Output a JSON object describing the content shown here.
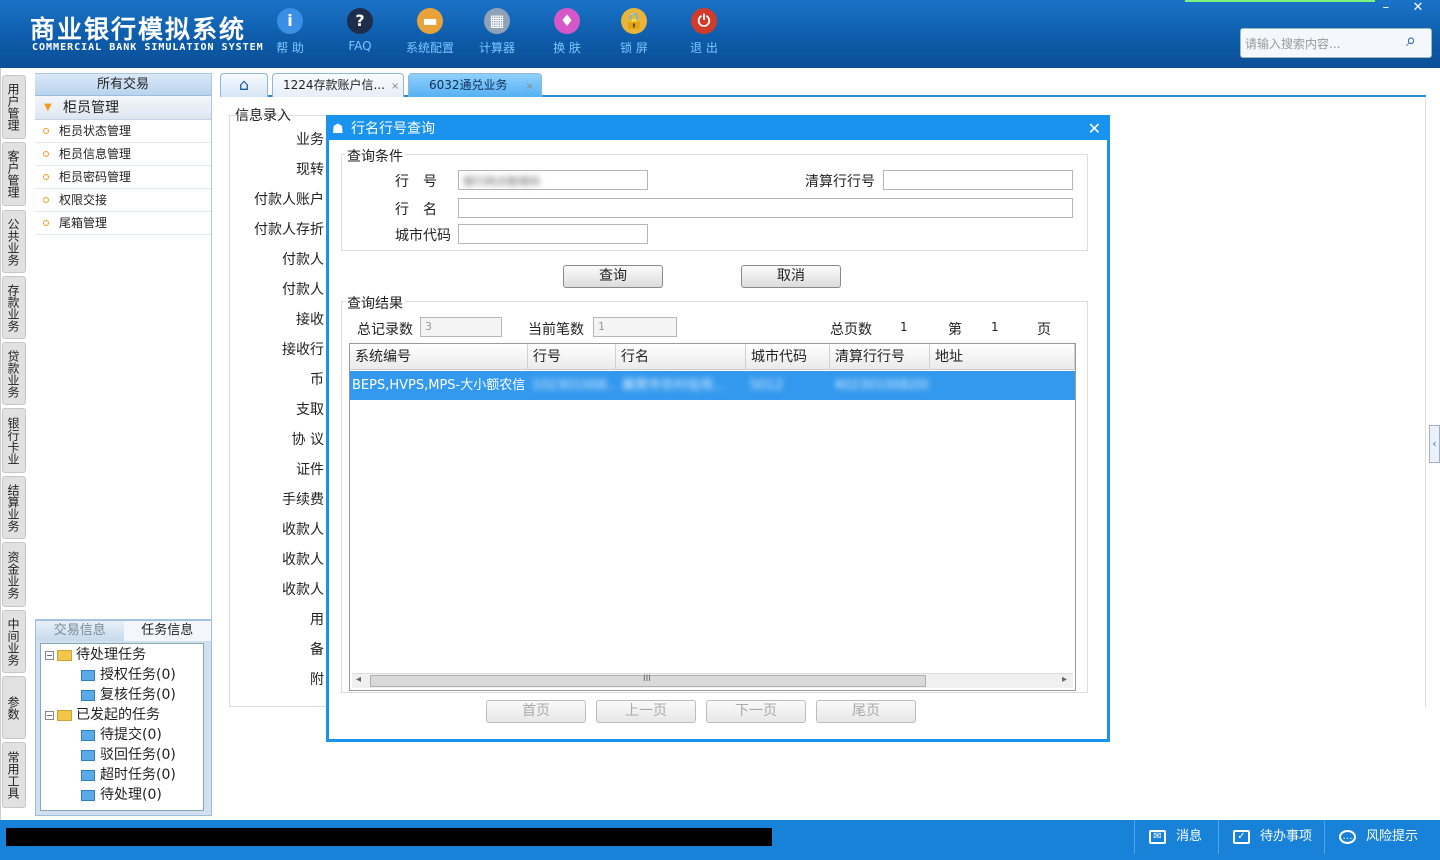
{
  "brand": {
    "cn": "商业银行模拟系统",
    "en": "COMMERCIAL BANK SIMULATION SYSTEM"
  },
  "toolbar": [
    {
      "label": "帮 助",
      "glyph": "i",
      "icon": "help-icon",
      "color": "#3a8ee6"
    },
    {
      "label": "FAQ",
      "glyph": "?",
      "icon": "faq-icon",
      "color": "#1e2d4a"
    },
    {
      "label": "系统配置",
      "glyph": "▬",
      "icon": "toolbox-icon",
      "color": "#e8a23a"
    },
    {
      "label": "计算器",
      "glyph": "▦",
      "icon": "calculator-icon",
      "color": "#8fa2b8"
    },
    {
      "label": "换 肤",
      "glyph": "♦",
      "icon": "skin-icon",
      "color": "#d657c8"
    },
    {
      "label": "锁 屏",
      "glyph": "🔒",
      "icon": "lock-icon",
      "color": "#e8b53a"
    },
    {
      "label": "退 出",
      "glyph": "⏻",
      "icon": "power-icon",
      "color": "#d23a2a"
    }
  ],
  "window": {
    "minimize": "–",
    "close": "✕"
  },
  "search": {
    "placeholder": "请输入搜索内容..."
  },
  "left_tabs": [
    "用户管理",
    "客户管理",
    "公共业务",
    "存款业务",
    "贷款业务",
    "银行卡业务",
    "结算业务",
    "资金业务",
    "中间业务",
    "参数",
    "常用工具"
  ],
  "nav": {
    "header": "所有交易",
    "group": "柜员管理",
    "items": [
      "柜员状态管理",
      "柜员信息管理",
      "柜员密码管理",
      "权限交接",
      "尾箱管理"
    ]
  },
  "task_panel": {
    "tab_trans": "交易信息",
    "tab_task": "任务信息",
    "tree": [
      {
        "label": "待处理任务",
        "level": 0,
        "folder": true
      },
      {
        "label": "授权任务(0)",
        "level": 1
      },
      {
        "label": "复核任务(0)",
        "level": 1
      },
      {
        "label": "已发起的任务",
        "level": 0,
        "folder": true
      },
      {
        "label": "待提交(0)",
        "level": 1
      },
      {
        "label": "驳回任务(0)",
        "level": 1
      },
      {
        "label": "超时任务(0)",
        "level": 1
      },
      {
        "label": "待处理(0)",
        "level": 1
      }
    ]
  },
  "tabs": {
    "home": "⌂",
    "tab1": "1224存款账户信...",
    "tab2": "6032通兑业务",
    "close": "×"
  },
  "form": {
    "legend": "信息录入",
    "labels": [
      "业务",
      "现转",
      "付款人账户",
      "付款人存折",
      "付款人",
      "付款人",
      "接收",
      "接收行",
      "币",
      "支取",
      "协 议",
      "证件",
      "手续费",
      "收款人",
      "收款人",
      "收款人",
      "用",
      "备",
      "附"
    ]
  },
  "dialog": {
    "title": "行名行号查询",
    "close": "✕",
    "query_legend": "查询条件",
    "bank_no_label": "行　号",
    "bank_no_value": "银行网点联络码",
    "clearing_label": "清算行行号",
    "bank_name_label": "行　名",
    "city_label": "城市代码",
    "query_btn": "查询",
    "cancel_btn": "取消",
    "result_legend": "查询结果",
    "total_label": "总记录数",
    "total_value": "3",
    "current_label": "当前笔数",
    "current_value": "1",
    "pages_label": "总页数",
    "pages_value": "1",
    "page_prefix": "第",
    "page_value": "1",
    "page_suffix": "页",
    "columns": [
      "系统编号",
      "行号",
      "行名",
      "城市代码",
      "清算行行号",
      "地址"
    ],
    "row": {
      "sys": "BEPS,HVPS,MPS-大小额农信",
      "bank_no": "102301008...",
      "bank_name": "襄樊市农村信用...",
      "city": "5012",
      "clearing": "402301008208",
      "addr": ""
    },
    "scroll_thumb": "III",
    "scroll_left": "◂",
    "scroll_right": "▸",
    "first_btn": "首页",
    "prev_btn": "上一页",
    "next_btn": "下一页",
    "last_btn": "尾页"
  },
  "status": {
    "msg": "消息",
    "todo": "待办事项",
    "risk": "风险提示"
  }
}
